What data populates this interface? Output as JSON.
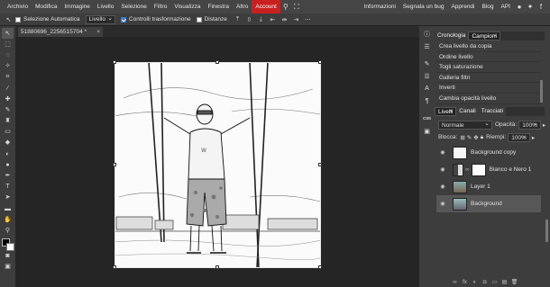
{
  "menubar": {
    "items": [
      "Archivio",
      "Modifica",
      "Immagine",
      "Livello",
      "Selezione",
      "Filtro",
      "Visualizza",
      "Finestra",
      "Altro"
    ],
    "account": "Account",
    "right": [
      "Informazioni",
      "Segnala un bug",
      "Apprendi",
      "Blog",
      "API"
    ],
    "account_color": "#c8201e"
  },
  "options": {
    "auto_select_label": "Selezione Automatica",
    "layer_select": "Livello",
    "transform_label": "Controlli trasformazione",
    "distances_label": "Distanze"
  },
  "document": {
    "tab_title": "51880696_2256515704 *",
    "close": "×"
  },
  "history_panel": {
    "tabs": [
      "Cronologia",
      "Campioni"
    ],
    "items": [
      "Crea livello da copia",
      "Ordine livello",
      "Togli saturazione",
      "Galleria filtri",
      "Inverti",
      "Cambia opacità livello"
    ]
  },
  "layers_panel": {
    "tabs": [
      "Livelli",
      "Canali",
      "Tracciati"
    ],
    "blend_mode": "Normale",
    "opacity_label": "Opacità:",
    "opacity_value": "100%",
    "lock_label": "Blocca:",
    "fill_label": "Riempi:",
    "fill_value": "100%",
    "layers": [
      {
        "name": "Background copy",
        "selected": false
      },
      {
        "name": "Bianco e Nero 1",
        "selected": false
      },
      {
        "name": "Layer 1",
        "selected": false
      },
      {
        "name": "Background",
        "selected": true
      }
    ]
  },
  "right_strip": {
    "ics_label": "CSS"
  },
  "accent_color": "#3a7bd5"
}
